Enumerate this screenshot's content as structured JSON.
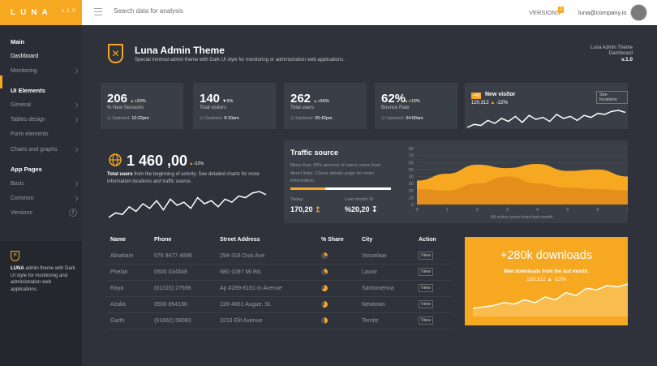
{
  "topbar": {
    "brand": "LUNA",
    "version": "v.1.0",
    "search_placeholder": "Search data for analysis",
    "versions_label": "VERSIONS",
    "versions_count": "2",
    "email": "luna@company.io"
  },
  "sidebar": {
    "sections": [
      {
        "title": "Main",
        "items": [
          {
            "label": "Dashboard",
            "active": true
          },
          {
            "label": "Monitoring",
            "chevron": true
          }
        ]
      },
      {
        "title": "UI Elements",
        "items": [
          {
            "label": "General",
            "chevron": true
          },
          {
            "label": "Tables design",
            "chevron": true
          },
          {
            "label": "Form elements"
          },
          {
            "label": "Charts and graphs",
            "chevron": true
          }
        ]
      },
      {
        "title": "App Pages",
        "items": [
          {
            "label": "Basic",
            "chevron": true
          },
          {
            "label": "Common",
            "chevron": true
          },
          {
            "label": "Versions",
            "badge": "2"
          }
        ]
      }
    ],
    "footer_brand": "LUNA",
    "footer_text": "admin theme with Dark UI style for monitoring and administration web applications."
  },
  "header": {
    "title": "Luna Admin Theme",
    "subtitle": "Special minimal admin theme with Dark UI style for monitoring or administration web applications.",
    "right_line1": "Luna Admin Theme",
    "right_line2": "Dashboard",
    "right_line3": "v.1.0"
  },
  "stats": [
    {
      "value": "206",
      "change": "+20%",
      "dir": "up",
      "label": "% New Sessions",
      "updated_prefix": "Updated:",
      "updated_time": "10:22pm"
    },
    {
      "value": "140",
      "change": "5%",
      "dir": "down",
      "label": "Total visitors",
      "updated_prefix": "Updated:",
      "updated_time": "9:10am"
    },
    {
      "value": "262",
      "change": "+56%",
      "dir": "up",
      "label": "Total users",
      "updated_prefix": "Updated:",
      "updated_time": "05:42pm"
    },
    {
      "value": "62%",
      "change": "+10%",
      "dir": "up",
      "label": "Bounce Rate",
      "updated_prefix": "Updated:",
      "updated_time": "04:00am"
    }
  ],
  "new_visitor": {
    "badge": "+40",
    "title": "New visitor",
    "value": "120,312",
    "change": "-22%",
    "button": "See locations"
  },
  "total_users": {
    "value": "1 460 ,00",
    "change": "-22%",
    "desc_bold": "Total users",
    "desc": "from the beginning of activity. See detailed charts for more information locations and traffic source."
  },
  "traffic": {
    "title": "Traffic source",
    "desc": "More than 30% percent of users come from direct links. Check details page for more information.",
    "progress": 0.35,
    "today_label": "Today",
    "today_value": "170,20",
    "month_label": "Last month %",
    "month_value": "%20,20",
    "chart_caption": "All active users from last month."
  },
  "table": {
    "headers": [
      "Name",
      "Phone",
      "Street Address",
      "% Share",
      "City",
      "Action"
    ],
    "rows": [
      {
        "name": "Abraham",
        "phone": "076 9477 4896",
        "address": "294-318 Duis Ave",
        "share": 0.25,
        "city": "Vosselaar",
        "action": "View"
      },
      {
        "name": "Phelan",
        "phone": "0500 034548",
        "address": "680-1097 Mi Rd.",
        "share": 0.35,
        "city": "Lavoir",
        "action": "View"
      },
      {
        "name": "Raya",
        "phone": "(01315) 27698",
        "address": "Ap #289-8161 In Avenue",
        "share": 0.65,
        "city": "Santomenna",
        "action": "View"
      },
      {
        "name": "Azalia",
        "phone": "0500 854198",
        "address": "226-4861 Augue. St.",
        "share": 0.6,
        "city": "Newtown",
        "action": "View"
      },
      {
        "name": "Garth",
        "phone": "(01662) 59083",
        "address": "3219 Elit Avenue",
        "share": 0.45,
        "city": "Ternitz",
        "action": "View"
      }
    ]
  },
  "downloads": {
    "title": "+280k downloads",
    "subtitle": "New downloads from the last month.",
    "value": "120,312",
    "change": "-22%"
  },
  "chart_data": [
    {
      "type": "area",
      "title": "",
      "x": [
        0,
        1,
        2,
        3,
        4,
        5,
        6,
        7
      ],
      "ylim": [
        0,
        80
      ],
      "yticks": [
        0,
        10,
        20,
        30,
        40,
        50,
        60,
        70,
        80
      ],
      "series": [
        {
          "values": [
            34,
            44,
            57,
            52,
            58,
            48,
            50,
            40
          ]
        },
        {
          "values": [
            22,
            20,
            30,
            40,
            30,
            24,
            22,
            20
          ]
        }
      ]
    },
    {
      "type": "line",
      "title": "",
      "values": [
        3,
        6,
        5,
        10,
        7,
        12,
        9,
        14,
        8,
        15,
        11,
        13,
        9,
        16,
        12,
        14,
        10,
        15,
        13,
        17,
        16,
        19,
        20,
        18
      ]
    },
    {
      "type": "line",
      "title": "",
      "values": [
        2,
        4,
        6,
        10,
        8,
        14,
        10,
        18,
        14,
        24,
        20,
        30,
        28,
        34,
        32,
        36
      ]
    }
  ]
}
